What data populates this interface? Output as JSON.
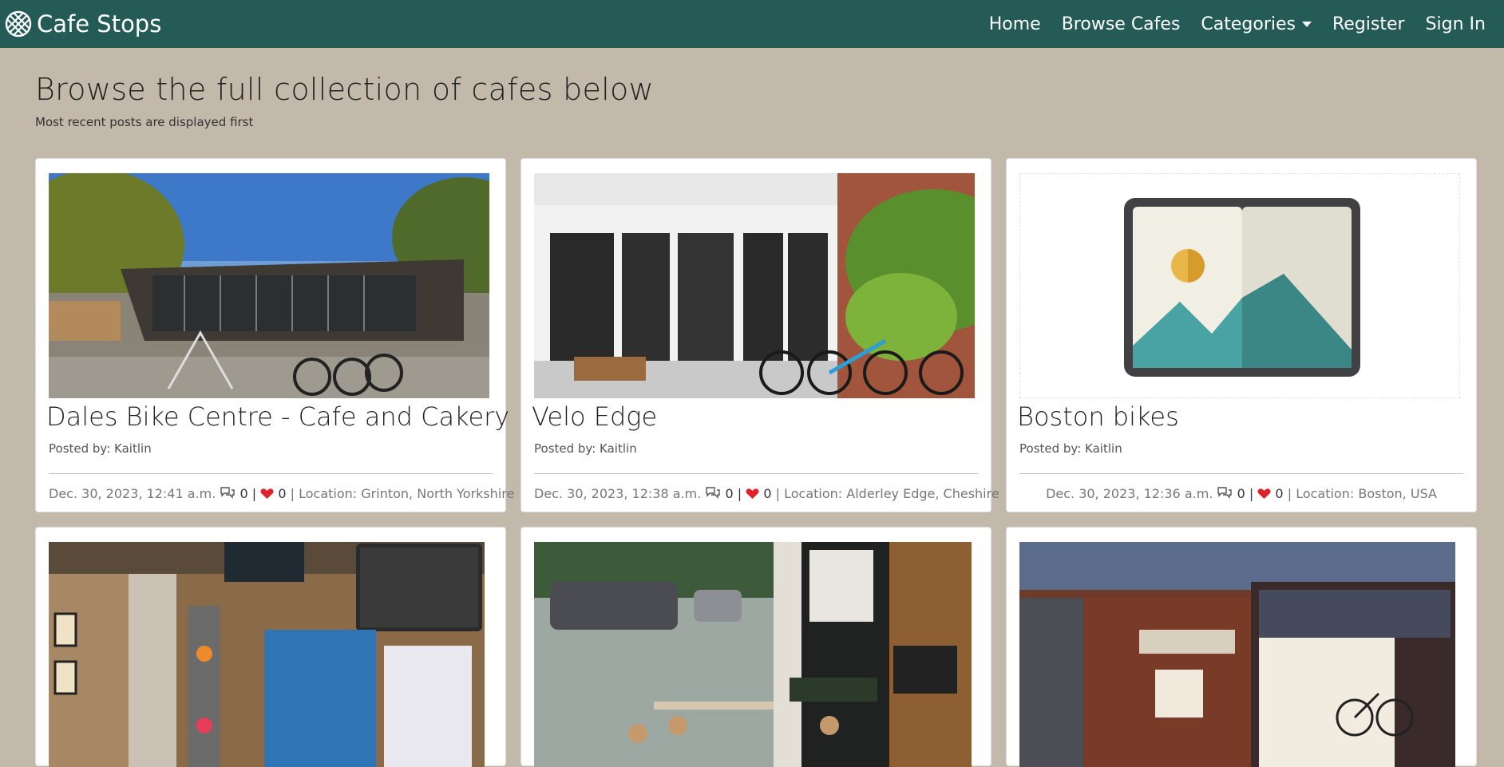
{
  "nav": {
    "brand": "Cafe Stops",
    "links": [
      "Home",
      "Browse Cafes",
      "Categories",
      "Register",
      "Sign In"
    ]
  },
  "page": {
    "title": "Browse the full collection of cafes below",
    "subtitle": "Most recent posts are displayed first"
  },
  "labels": {
    "posted_by": "Posted by:",
    "location": "Location:"
  },
  "cafes": [
    {
      "title": "Dales Bike Centre - Cafe and Cakery",
      "author": "Kaitlin",
      "date": "Dec. 30, 2023, 12:41 a.m.",
      "comments": "0",
      "likes": "0",
      "location": "Grinton, North Yorkshire"
    },
    {
      "title": "Velo Edge",
      "author": "Kaitlin",
      "date": "Dec. 30, 2023, 12:38 a.m.",
      "comments": "0",
      "likes": "0",
      "location": "Alderley Edge, Cheshire"
    },
    {
      "title": "Boston bikes",
      "author": "Kaitlin",
      "date": "Dec. 30, 2023, 12:36 a.m.",
      "comments": "0",
      "likes": "0",
      "location": "Boston, USA"
    }
  ],
  "colors": {
    "navbar": "#245b57",
    "background": "#c3b9ab",
    "heart": "#e0232a"
  }
}
